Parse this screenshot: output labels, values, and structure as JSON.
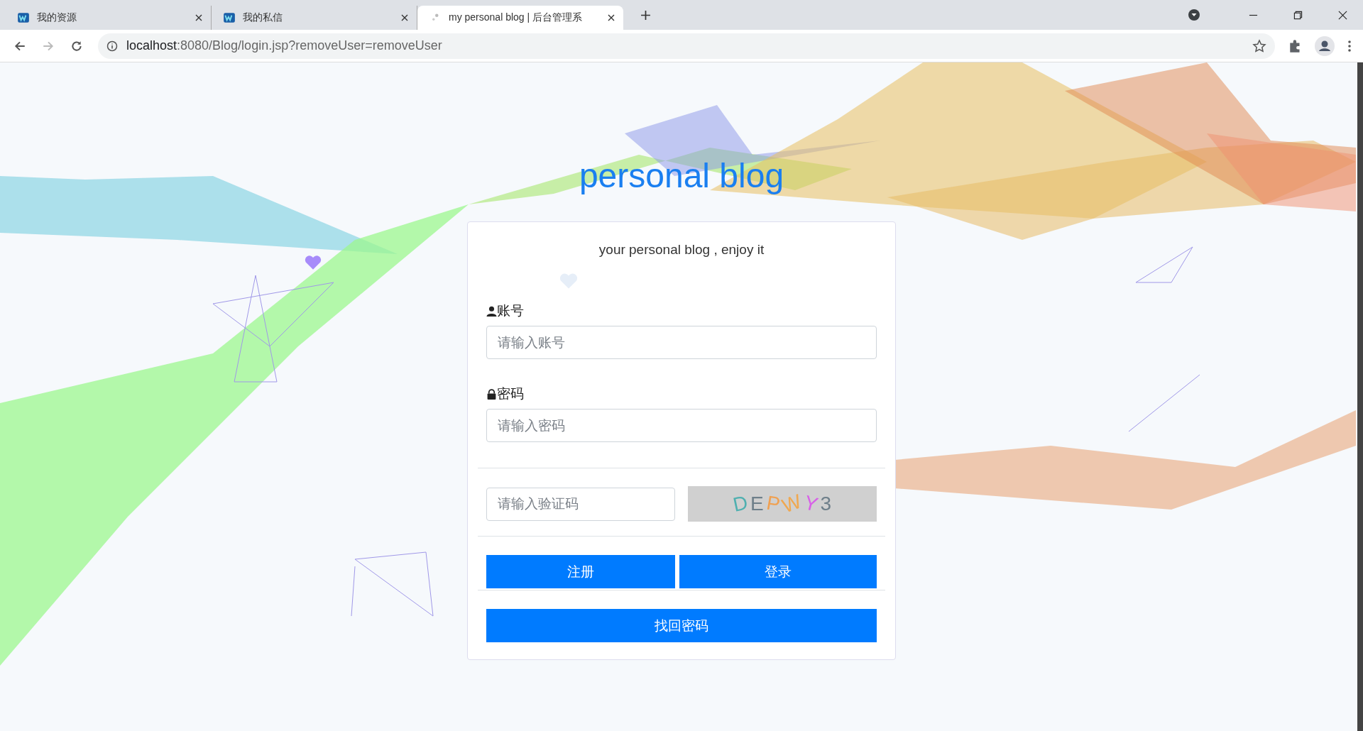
{
  "browser": {
    "tabs": [
      {
        "title": "我的资源",
        "selected": false,
        "kind": "logo"
      },
      {
        "title": "我的私信",
        "selected": false,
        "kind": "logo"
      },
      {
        "title": "my personal blog | 后台管理系",
        "selected": true,
        "kind": "blank"
      }
    ],
    "url": {
      "host": "localhost",
      "rest": ":8080/Blog/login.jsp?removeUser=removeUser"
    }
  },
  "page": {
    "title": "personal blog",
    "subtitle": "your personal blog , enjoy it",
    "fields": [
      {
        "label": "账号",
        "kind": "user",
        "placeholder": "请输入账号"
      },
      {
        "label": "密码",
        "kind": "lock",
        "placeholder": "请输入密码"
      }
    ],
    "captcha": {
      "placeholder": "请输入验证码",
      "chars": [
        {
          "char": "D",
          "color": "#4fb0b0"
        },
        {
          "char": "E",
          "color": "#6e7f8a"
        },
        {
          "char": "P",
          "color": "#f0a050"
        },
        {
          "char": "W",
          "color": "#f0a850"
        },
        {
          "char": "Y",
          "color": "#d860e8"
        },
        {
          "char": "3",
          "color": "#6e7f8a"
        }
      ]
    },
    "buttons": [
      "注册",
      "登录"
    ],
    "recover_button": "找回密码"
  }
}
